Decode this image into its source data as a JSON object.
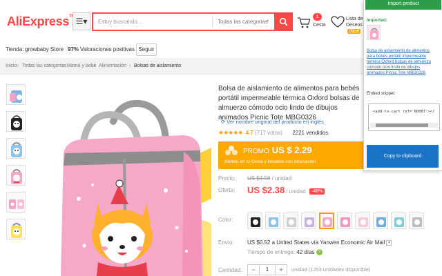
{
  "header": {
    "logo": "AliExpress",
    "search_placeholder": "Estoy buscando...",
    "search_category": "Todas las categorias",
    "cart_count": "1",
    "cart_label": "Cesta",
    "wishlist_line1": "Lista de",
    "wishlist_line2": "Deseos",
    "wishlist_new": "¡Nue"
  },
  "store": {
    "label": "Tienda:",
    "name": "growbaby Store",
    "rating": "97%",
    "rating_label": "Valoraciones positivas",
    "follow": "Seguir"
  },
  "breadcrumb": [
    "Inicio",
    "Todas las categorías",
    "Mamá y bebé",
    "Alimentación",
    "Bolsas de aislamiento"
  ],
  "product": {
    "title": "Bolsa de aislamiento de alimentos para bebés portátil impermeable térmica Oxford bolsas de almuerzo cómodo ocio lindo de dibujos animados Picnic Tote MBG0326",
    "original_link": "Ver nombre original del producto en inglés",
    "rating": "4.7",
    "votes": "(717 votos)",
    "sold": "2221 vendidos",
    "promo_label": "PROMO",
    "promo_price": "US $ 2.29",
    "promo_sub": "¡Mételo en tu Cesta y llévatelo con descuento!",
    "price_label": "Precio:",
    "old_price": "US $4.58",
    "unit_old": "/ unidad",
    "offer_label": "Oferta:",
    "new_price": "US $2.38",
    "unit_new": "/ unidad",
    "discount": "-48%",
    "color_label": "Color:",
    "shipping_label": "Envío:",
    "shipping_value": "US $0.52 a United States vía Yanwen Economic Air Mail",
    "delivery_label": "Tiempo de entrega:",
    "delivery_value": "42 días",
    "quantity_label": "Cantidad:",
    "quantity": "1",
    "available": "unidad (1253 unidades disponible)"
  },
  "extension": {
    "import_button": "Import product",
    "imported_label": "Imported:",
    "imported_link": "Bolsa de aislamiento de alimentos para bebés portátil impermeable térmica Oxford bolsas de almuerzo cómodo ocio lindo de dibujos animados Picnic Tote MBG0326",
    "embed_label": "Embed snippet:",
    "snippet": "<add-to-cart ref='R0007'></",
    "copy_button": "Copy to clipboard"
  },
  "colors": {
    "brand": "#ff4747",
    "promo": "#ffa800",
    "ext_green": "#2e9d4a",
    "ext_blue": "#1a73c6"
  }
}
